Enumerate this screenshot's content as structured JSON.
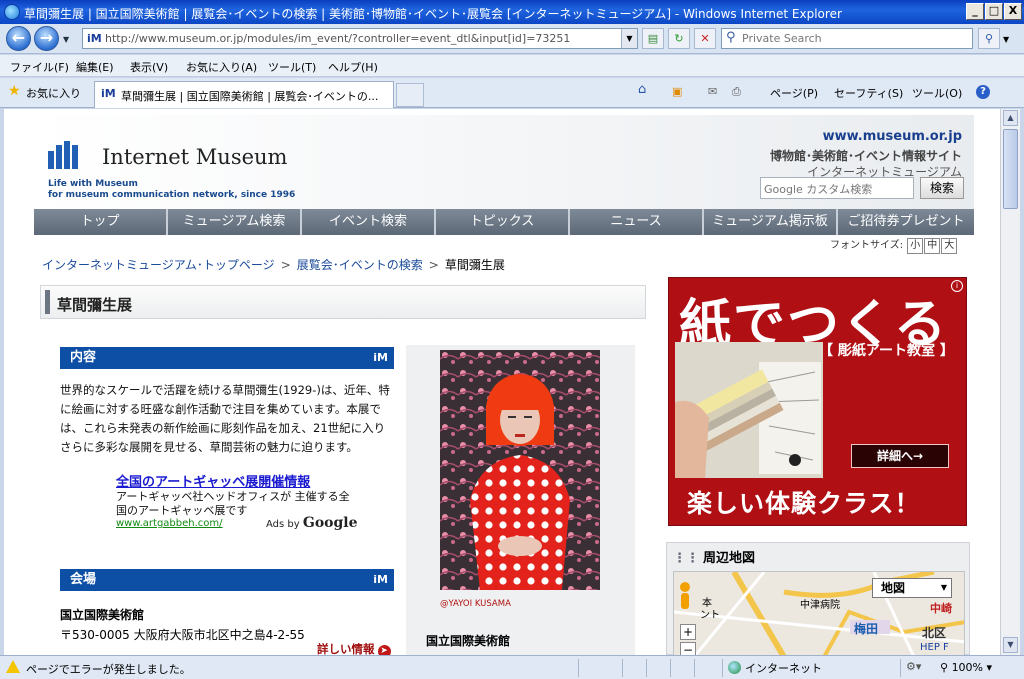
{
  "window": {
    "title": "草間彌生展 | 国立国際美術館 | 展覧会･イベントの検索 | 美術館･博物館･イベント･展覧会 [インターネットミュージアム] - Windows Internet Explorer",
    "minimize": "_",
    "maximize": "□",
    "close": "X"
  },
  "addressbar": {
    "url": "http://www.museum.or.jp/modules/im_event/?controller=event_dtl&input[id]=73251",
    "favicon": "iM",
    "search_placeholder": "Private Search"
  },
  "menubar": {
    "items": [
      "ファイル(F)",
      "編集(E)",
      "表示(V)",
      "お気に入り(A)",
      "ツール(T)",
      "ヘルプ(H)"
    ]
  },
  "favbar": {
    "favorites_label": "お気に入り",
    "tab_title": "草間彌生展 | 国立国際美術館 | 展覧会･イベントの...",
    "page_label": "ページ(P)",
    "safety_label": "セーフティ(S)",
    "tools_label": "ツール(O)"
  },
  "site": {
    "logo_text": "Internet Museum",
    "tagline1": "Life with Museum",
    "tagline2": "for museum communication network, since 1996",
    "domain": "www.museum.or.jp",
    "sub1": "博物館･美術館･イベント情報サイト",
    "sub2": "インターネットミュージアム",
    "search_placeholder": "Google カスタム検索",
    "search_button": "検索"
  },
  "gnav": {
    "items": [
      "トップ",
      "ミュージアム検索",
      "イベント検索",
      "トピックス",
      "ニュース",
      "ミュージアム掲示板",
      "ご招待券プレゼント"
    ]
  },
  "fontsize": {
    "label": "フォントサイズ:",
    "small": "小",
    "medium": "中",
    "large": "大"
  },
  "breadcrumb": {
    "items": [
      "インターネットミュージアム･トップページ",
      "展覧会･イベントの検索",
      "草間彌生展"
    ],
    "separator": ">"
  },
  "page": {
    "title": "草間彌生展",
    "content_heading": "内容",
    "description": "世界的なスケールで活躍を続ける草間彌生(1929-)は、近年、特に絵画に対する旺盛な創作活動で注目を集めています。本展では、これら未発表の新作絵画に彫刻作品を加え、21世紀に入りさらに多彩な展開を見せる、草間芸術の魅力に迫ります。",
    "venue_heading": "会場",
    "venue_name": "国立国際美術館",
    "venue_address": "〒530-0005 大阪府大阪市北区中之島4-2-55",
    "venue_more": "詳しい情報",
    "heading_icon": "iM"
  },
  "ad": {
    "link": "全国のアートギャッベ展開催情報",
    "text": "アートギャッベ社ヘッドオフィスが 主催する全国のアートギャッベ展です",
    "url": "www.artgabbeh.com/",
    "ads_by": "Ads by",
    "google": "Google"
  },
  "photo": {
    "credit": "@YAYOI KUSAMA",
    "venue": "国立国際美術館"
  },
  "banner": {
    "headline": "紙でつくる",
    "subhead": "【 彫紙アート教室 】",
    "button": "詳細へ→",
    "bottom": "楽しい体験クラス！",
    "info": "i"
  },
  "map": {
    "heading": "周辺地図",
    "type_select": "地図",
    "labels": [
      "中津病院",
      "梅田",
      "北区",
      "中崎",
      "本",
      "ント",
      "HEP F"
    ]
  },
  "statusbar": {
    "message": "ページでエラーが発生しました。",
    "zone": "インターネット",
    "zoom": "100%"
  },
  "colors": {
    "accent_blue": "#0e4fa6",
    "banner_red": "#b00f14",
    "nav_gray": "#6e7987"
  }
}
